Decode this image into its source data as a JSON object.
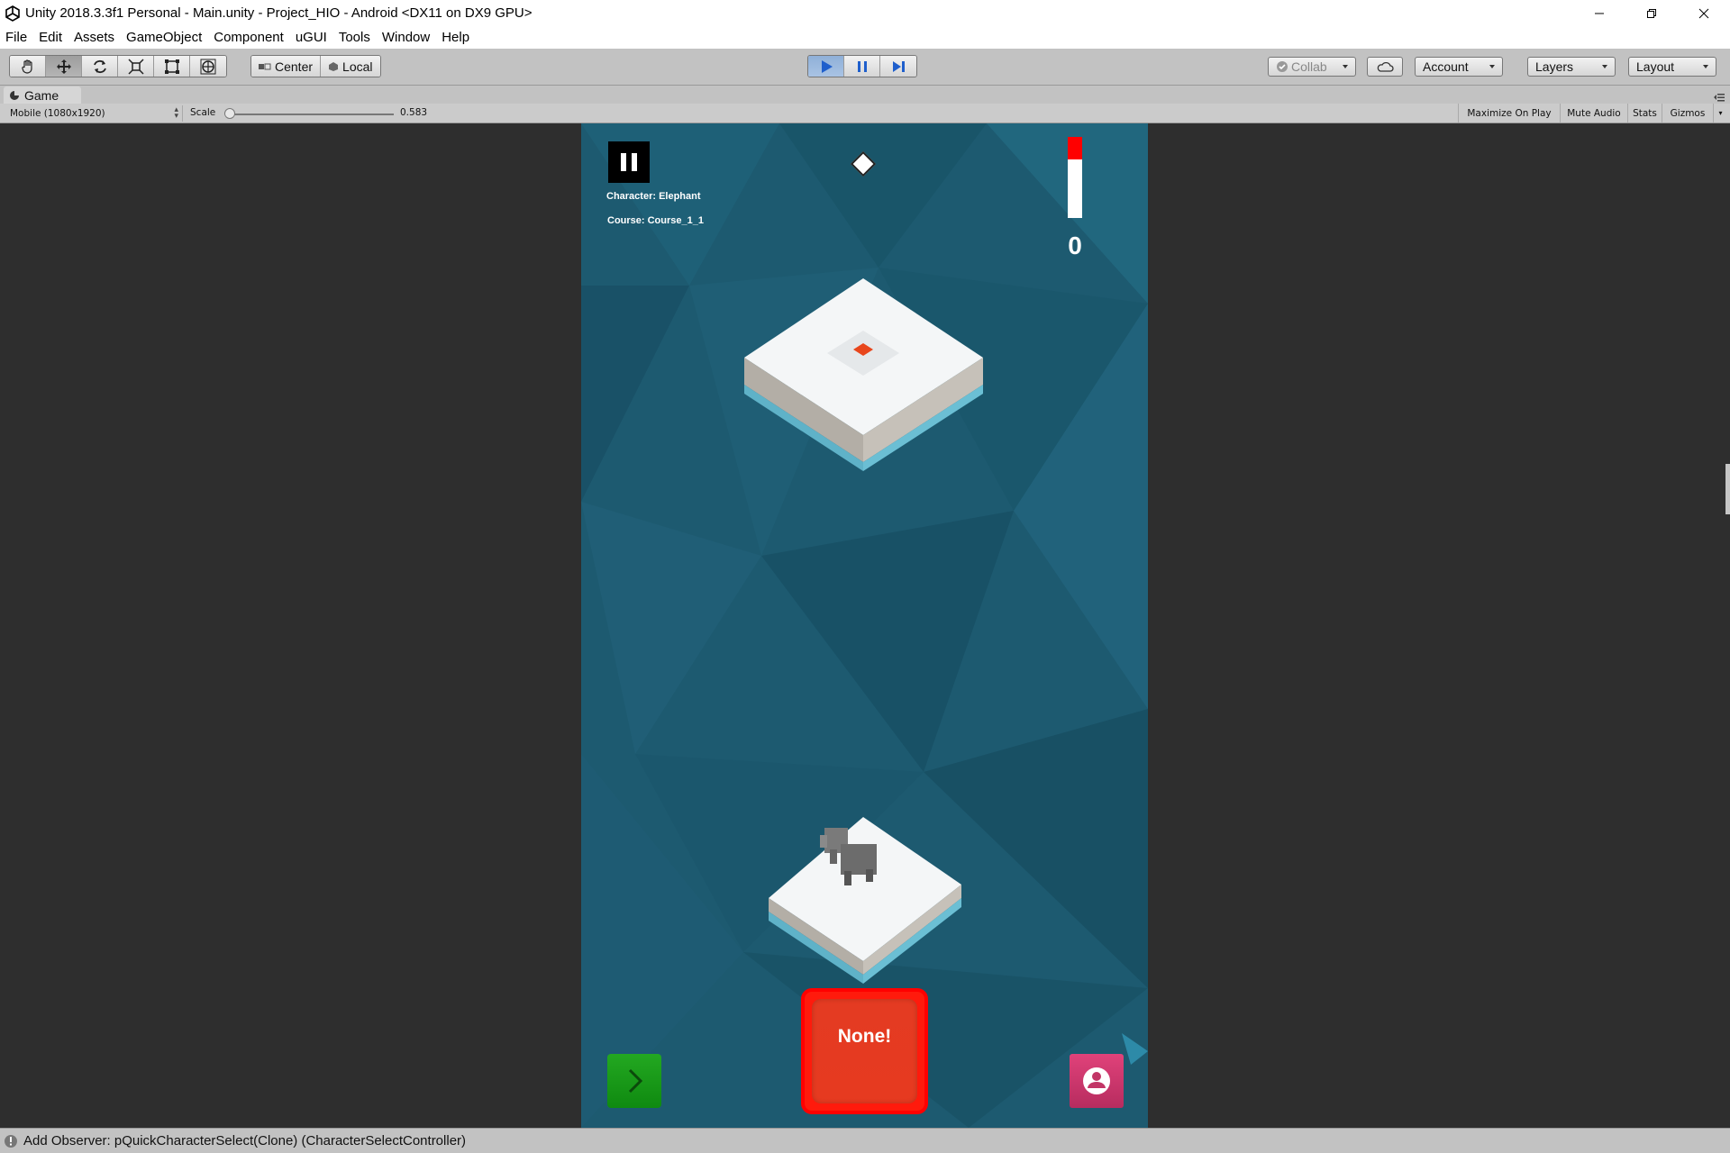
{
  "window": {
    "title": "Unity 2018.3.3f1 Personal - Main.unity - Project_HIO - Android <DX11 on DX9 GPU>"
  },
  "menu": [
    "File",
    "Edit",
    "Assets",
    "GameObject",
    "Component",
    "uGUI",
    "Tools",
    "Window",
    "Help"
  ],
  "toolbar": {
    "transform_tools": [
      "hand-tool",
      "move-tool",
      "rotate-tool",
      "scale-tool",
      "rect-tool",
      "transform-tool"
    ],
    "active_tool": "move-tool",
    "pivot_label": "Center",
    "space_label": "Local",
    "play_state": "playing",
    "collab_label": "Collab",
    "account_label": "Account",
    "layers_label": "Layers",
    "layout_label": "Layout"
  },
  "game_tab": {
    "label": "Game"
  },
  "game_bar": {
    "resolution": "Mobile (1080x1920)",
    "scale_label": "Scale",
    "scale_value": "0.583",
    "scale_fraction": 0.0,
    "buttons": [
      "Maximize On Play",
      "Mute Audio",
      "Stats",
      "Gizmos"
    ]
  },
  "game": {
    "character_text": "Character: Elephant",
    "course_text": "Course: Course_1_1",
    "score": "0",
    "meter_fill_fraction": 0.28,
    "action_button": "None!",
    "colors": {
      "ocean": "#1d5a70",
      "meter_red": "#ff0000",
      "action_red": "#ff1a0c",
      "next_green": "#1a9b1a",
      "character_pink": "#c8356a"
    }
  },
  "status": {
    "message": "Add Observer: pQuickCharacterSelect(Clone) (CharacterSelectController)"
  }
}
